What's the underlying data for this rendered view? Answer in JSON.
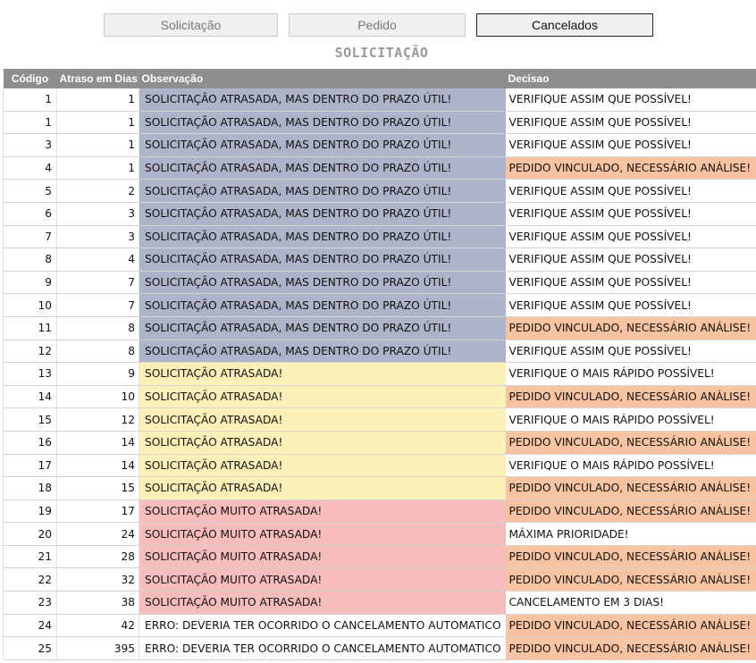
{
  "tabs": [
    {
      "label": "Solicitação",
      "active": false
    },
    {
      "label": "Pedido",
      "active": false
    },
    {
      "label": "Cancelados",
      "active": true
    }
  ],
  "title": "SOLICITAÇÃO",
  "columns": [
    "Código",
    "Atraso em Dias",
    "Observação",
    "Decisao"
  ],
  "colors": {
    "late_within_term": "#adb3c9",
    "late": "#fbf1b8",
    "very_late": "#f7bcbc",
    "linked_order": "#f8c3a0",
    "header": "#8e8e8e"
  },
  "rows": [
    {
      "code": "1",
      "delay": "1",
      "obs": "SOLICITAÇÃO ATRASADA, MAS DENTRO DO PRAZO ÚTIL!",
      "obs_class": "late-ok",
      "decision": "VERIFIQUE ASSIM QUE POSSÍVEL!",
      "dec_class": "plain"
    },
    {
      "code": "1",
      "delay": "1",
      "obs": "SOLICITAÇÃO ATRASADA, MAS DENTRO DO PRAZO ÚTIL!",
      "obs_class": "late-ok",
      "decision": "VERIFIQUE ASSIM QUE POSSÍVEL!",
      "dec_class": "plain"
    },
    {
      "code": "3",
      "delay": "1",
      "obs": "SOLICITAÇÃO ATRASADA, MAS DENTRO DO PRAZO ÚTIL!",
      "obs_class": "late-ok",
      "decision": "VERIFIQUE ASSIM QUE POSSÍVEL!",
      "dec_class": "plain"
    },
    {
      "code": "4",
      "delay": "1",
      "obs": "SOLICITAÇÃO ATRASADA, MAS DENTRO DO PRAZO ÚTIL!",
      "obs_class": "late-ok",
      "decision": "PEDIDO VINCULADO, NECESSÁRIO ANÁLISE!",
      "dec_class": "linked"
    },
    {
      "code": "5",
      "delay": "2",
      "obs": "SOLICITAÇÃO ATRASADA, MAS DENTRO DO PRAZO ÚTIL!",
      "obs_class": "late-ok",
      "decision": "VERIFIQUE ASSIM QUE POSSÍVEL!",
      "dec_class": "plain"
    },
    {
      "code": "6",
      "delay": "3",
      "obs": "SOLICITAÇÃO ATRASADA, MAS DENTRO DO PRAZO ÚTIL!",
      "obs_class": "late-ok",
      "decision": "VERIFIQUE ASSIM QUE POSSÍVEL!",
      "dec_class": "plain"
    },
    {
      "code": "7",
      "delay": "3",
      "obs": "SOLICITAÇÃO ATRASADA, MAS DENTRO DO PRAZO ÚTIL!",
      "obs_class": "late-ok",
      "decision": "VERIFIQUE ASSIM QUE POSSÍVEL!",
      "dec_class": "plain"
    },
    {
      "code": "8",
      "delay": "4",
      "obs": "SOLICITAÇÃO ATRASADA, MAS DENTRO DO PRAZO ÚTIL!",
      "obs_class": "late-ok",
      "decision": "VERIFIQUE ASSIM QUE POSSÍVEL!",
      "dec_class": "plain"
    },
    {
      "code": "9",
      "delay": "7",
      "obs": "SOLICITAÇÃO ATRASADA, MAS DENTRO DO PRAZO ÚTIL!",
      "obs_class": "late-ok",
      "decision": "VERIFIQUE ASSIM QUE POSSÍVEL!",
      "dec_class": "plain"
    },
    {
      "code": "10",
      "delay": "7",
      "obs": "SOLICITAÇÃO ATRASADA, MAS DENTRO DO PRAZO ÚTIL!",
      "obs_class": "late-ok",
      "decision": "VERIFIQUE ASSIM QUE POSSÍVEL!",
      "dec_class": "plain"
    },
    {
      "code": "11",
      "delay": "8",
      "obs": "SOLICITAÇÃO ATRASADA, MAS DENTRO DO PRAZO ÚTIL!",
      "obs_class": "late-ok",
      "decision": "PEDIDO VINCULADO, NECESSÁRIO ANÁLISE!",
      "dec_class": "linked"
    },
    {
      "code": "12",
      "delay": "8",
      "obs": "SOLICITAÇÃO ATRASADA, MAS DENTRO DO PRAZO ÚTIL!",
      "obs_class": "late-ok",
      "decision": "VERIFIQUE ASSIM QUE POSSÍVEL!",
      "dec_class": "plain"
    },
    {
      "code": "13",
      "delay": "9",
      "obs": "SOLICITAÇÃO ATRASADA!",
      "obs_class": "late",
      "decision": "VERIFIQUE O MAIS RÁPIDO POSSÍVEL!",
      "dec_class": "plain"
    },
    {
      "code": "14",
      "delay": "10",
      "obs": "SOLICITAÇÃO ATRASADA!",
      "obs_class": "late",
      "decision": "PEDIDO VINCULADO, NECESSÁRIO ANÁLISE!",
      "dec_class": "linked"
    },
    {
      "code": "15",
      "delay": "12",
      "obs": "SOLICITAÇÃO ATRASADA!",
      "obs_class": "late",
      "decision": "VERIFIQUE O MAIS RÁPIDO POSSÍVEL!",
      "dec_class": "plain"
    },
    {
      "code": "16",
      "delay": "14",
      "obs": "SOLICITAÇÃO ATRASADA!",
      "obs_class": "late",
      "decision": "PEDIDO VINCULADO, NECESSÁRIO ANÁLISE!",
      "dec_class": "linked"
    },
    {
      "code": "17",
      "delay": "14",
      "obs": "SOLICITAÇÃO ATRASADA!",
      "obs_class": "late",
      "decision": "VERIFIQUE O MAIS RÁPIDO POSSÍVEL!",
      "dec_class": "plain"
    },
    {
      "code": "18",
      "delay": "15",
      "obs": "SOLICITAÇÃO ATRASADA!",
      "obs_class": "late",
      "decision": "PEDIDO VINCULADO, NECESSÁRIO ANÁLISE!",
      "dec_class": "linked"
    },
    {
      "code": "19",
      "delay": "17",
      "obs": "SOLICITAÇÃO MUITO ATRASADA!",
      "obs_class": "very-late",
      "decision": "PEDIDO VINCULADO, NECESSÁRIO ANÁLISE!",
      "dec_class": "linked"
    },
    {
      "code": "20",
      "delay": "24",
      "obs": "SOLICITAÇÃO MUITO ATRASADA!",
      "obs_class": "very-late",
      "decision": "MÁXIMA PRIORIDADE!",
      "dec_class": "plain"
    },
    {
      "code": "21",
      "delay": "28",
      "obs": "SOLICITAÇÃO MUITO ATRASADA!",
      "obs_class": "very-late",
      "decision": "PEDIDO VINCULADO, NECESSÁRIO ANÁLISE!",
      "dec_class": "linked"
    },
    {
      "code": "22",
      "delay": "32",
      "obs": "SOLICITAÇÃO MUITO ATRASADA!",
      "obs_class": "very-late",
      "decision": "PEDIDO VINCULADO, NECESSÁRIO ANÁLISE!",
      "dec_class": "linked"
    },
    {
      "code": "23",
      "delay": "38",
      "obs": "SOLICITAÇÃO MUITO ATRASADA!",
      "obs_class": "very-late",
      "decision": "CANCELAMENTO EM 3 DIAS!",
      "dec_class": "plain"
    },
    {
      "code": "24",
      "delay": "42",
      "obs": "ERRO: DEVERIA TER OCORRIDO O CANCELAMENTO AUTOMATICO",
      "obs_class": "error",
      "decision": "PEDIDO VINCULADO, NECESSÁRIO ANÁLISE!",
      "dec_class": "linked"
    },
    {
      "code": "25",
      "delay": "395",
      "obs": "ERRO: DEVERIA TER OCORRIDO O CANCELAMENTO AUTOMATICO",
      "obs_class": "error",
      "decision": "PEDIDO VINCULADO, NECESSÁRIO ANÁLISE!",
      "dec_class": "linked"
    }
  ]
}
